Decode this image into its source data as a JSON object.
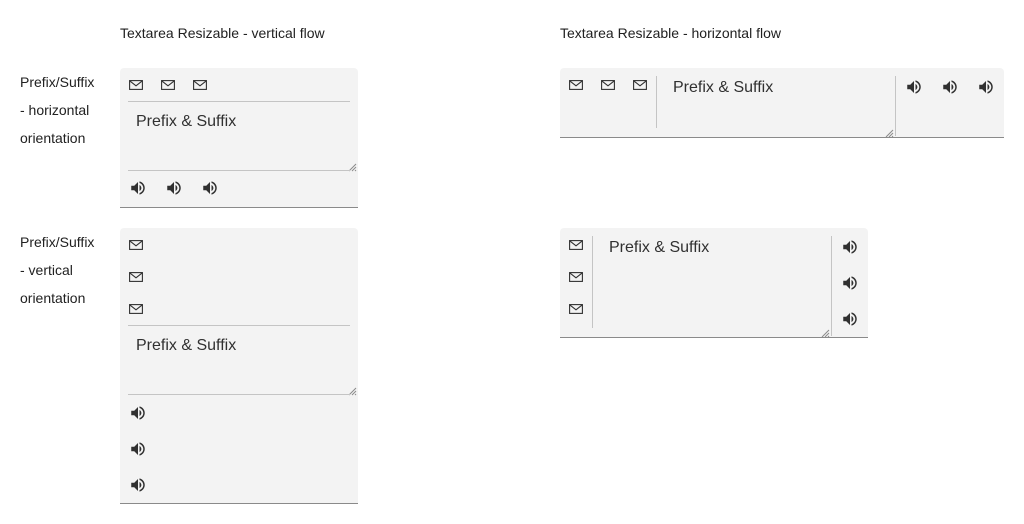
{
  "columns": {
    "vertical_flow": "Textarea Resizable - vertical flow",
    "horizontal_flow": "Textarea Resizable - horizontal flow"
  },
  "rows": {
    "horizontal_orientation": [
      "Prefix/Suffix",
      "- horizontal",
      "orientation"
    ],
    "vertical_orientation": [
      "Prefix/Suffix",
      "- vertical",
      "orientation"
    ]
  },
  "fields": {
    "value": "Prefix & Suffix"
  },
  "icons": {
    "prefix": "mail-icon",
    "suffix": "volume-up-icon"
  },
  "colors": {
    "field_bg": "#f3f3f3",
    "underline": "#8a8a8a",
    "divider": "#c4c4c4",
    "icon": "#303030"
  }
}
